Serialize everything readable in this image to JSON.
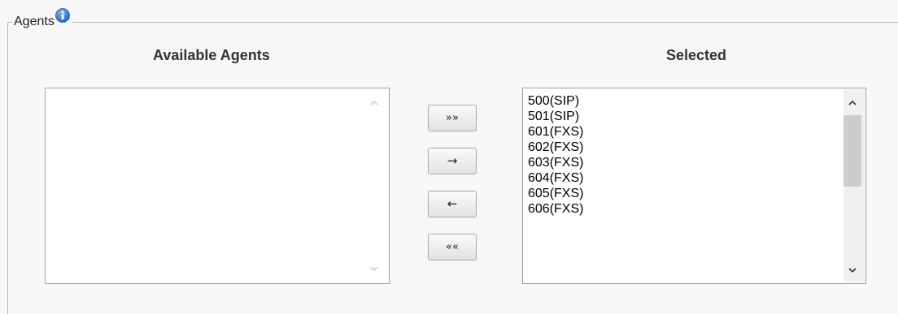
{
  "section": {
    "legend": "Agents"
  },
  "available": {
    "heading": "Available Agents",
    "items": []
  },
  "selected": {
    "heading": "Selected",
    "items": [
      "500(SIP)",
      "501(SIP)",
      "601(FXS)",
      "602(FXS)",
      "603(FXS)",
      "604(FXS)",
      "605(FXS)",
      "606(FXS)"
    ]
  },
  "buttons": {
    "add_all": "»»",
    "add_one": "→",
    "remove_one": "←",
    "remove_all": "««"
  },
  "icons": {
    "info": "info-icon",
    "scroll_up": "chevron-up-icon",
    "scroll_down": "chevron-down-icon"
  },
  "colors": {
    "info_icon": "#3a7fd5",
    "background": "#f7f7f7"
  }
}
